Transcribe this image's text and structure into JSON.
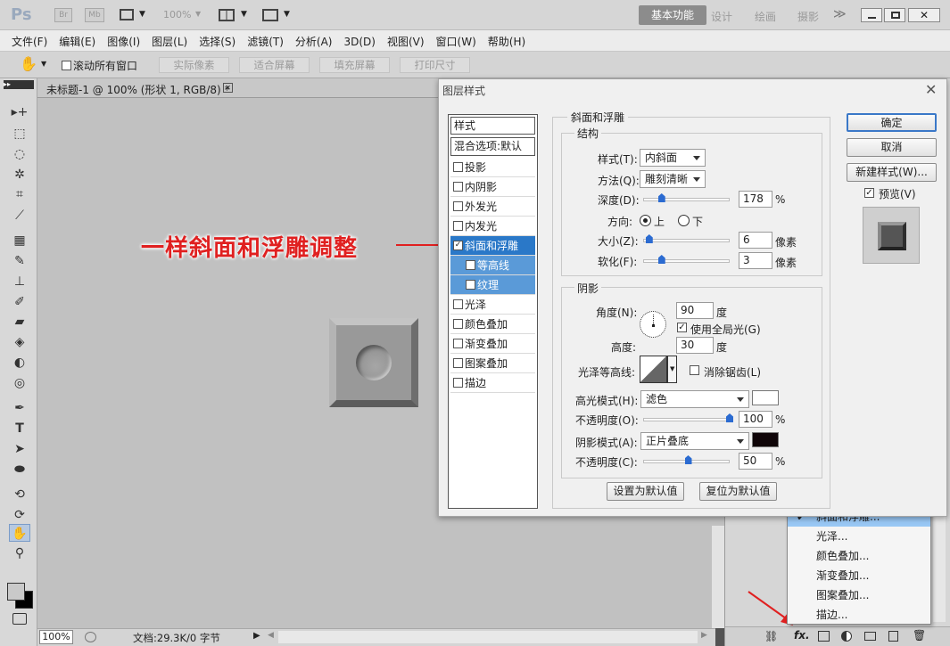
{
  "app": {
    "logo": "Ps",
    "bridge": "Br",
    "minibridge": "Mb",
    "zoom_select": "100%",
    "workspaces": [
      "基本功能",
      "设计",
      "绘画",
      "摄影"
    ],
    "more": "≫"
  },
  "menu": [
    "文件(F)",
    "编辑(E)",
    "图像(I)",
    "图层(L)",
    "选择(S)",
    "滤镜(T)",
    "分析(A)",
    "3D(D)",
    "视图(V)",
    "窗口(W)",
    "帮助(H)"
  ],
  "options": {
    "scroll_all_label": "滚动所有窗口",
    "buttons": [
      "实际像素",
      "适合屏幕",
      "填充屏幕",
      "打印尺寸"
    ]
  },
  "document": {
    "tab_title": "未标题-1 @ 100% (形状 1, RGB/8) *",
    "zoom": "100%",
    "doc_info": "文档:29.3K/0 字节"
  },
  "annotation": {
    "text": "一样斜面和浮雕调整",
    "color": "#e02020"
  },
  "dialog": {
    "title": "图层样式",
    "styles_header": "样式",
    "blend_default": "混合选项:默认",
    "styles": [
      {
        "label": "投影",
        "checked": false
      },
      {
        "label": "内阴影",
        "checked": false
      },
      {
        "label": "外发光",
        "checked": false
      },
      {
        "label": "内发光",
        "checked": false
      },
      {
        "label": "斜面和浮雕",
        "checked": true,
        "selected": true
      },
      {
        "label": "等高线",
        "checked": false,
        "sub": true
      },
      {
        "label": "纹理",
        "checked": false,
        "sub": true
      },
      {
        "label": "光泽",
        "checked": false
      },
      {
        "label": "颜色叠加",
        "checked": false
      },
      {
        "label": "渐变叠加",
        "checked": false
      },
      {
        "label": "图案叠加",
        "checked": false
      },
      {
        "label": "描边",
        "checked": false
      }
    ],
    "bevel": {
      "section": "斜面和浮雕",
      "structure": "结构",
      "style_label": "样式(T):",
      "style_value": "内斜面",
      "technique_label": "方法(Q):",
      "technique_value": "雕刻清晰",
      "depth_label": "深度(D):",
      "depth_value": "178",
      "depth_unit": "%",
      "depth_fraction": 0.18,
      "direction_label": "方向:",
      "direction_up": "上",
      "direction_down": "下",
      "size_label": "大小(Z):",
      "size_value": "6",
      "size_unit": "像素",
      "size_fraction": 0.03,
      "soften_label": "软化(F):",
      "soften_value": "3",
      "soften_unit": "像素",
      "soften_fraction": 0.18
    },
    "shading": {
      "section": "阴影",
      "angle_label": "角度(N):",
      "angle_value": "90",
      "angle_unit": "度",
      "global_light_label": "使用全局光(G)",
      "altitude_label": "高度:",
      "altitude_value": "30",
      "altitude_unit": "度",
      "gloss_label": "光泽等高线:",
      "antialias_label": "消除锯齿(L)",
      "highlight_mode_label": "高光模式(H):",
      "highlight_mode_value": "滤色",
      "highlight_color": "#ffffff",
      "highlight_opacity_label": "不透明度(O):",
      "highlight_opacity_value": "100",
      "highlight_opacity_fraction": 1.0,
      "shadow_mode_label": "阴影模式(A):",
      "shadow_mode_value": "正片叠底",
      "shadow_color": "#0f0508",
      "shadow_opacity_label": "不透明度(C):",
      "shadow_opacity_value": "50",
      "shadow_opacity_fraction": 0.5,
      "pct": "%"
    },
    "set_default": "设置为默认值",
    "reset_default": "复位为默认值",
    "ok": "确定",
    "cancel": "取消",
    "new_style": "新建样式(W)...",
    "preview_label": "预览(V)"
  },
  "fx_menu": {
    "items": [
      "斜面和浮雕...",
      "光泽...",
      "颜色叠加...",
      "渐变叠加...",
      "图案叠加...",
      "描边..."
    ],
    "checked_index": 0
  },
  "colors": {
    "selection": "#2a78c8",
    "accent_blue": "#2b6bd1",
    "menu_highlight": "#99c8f5"
  }
}
